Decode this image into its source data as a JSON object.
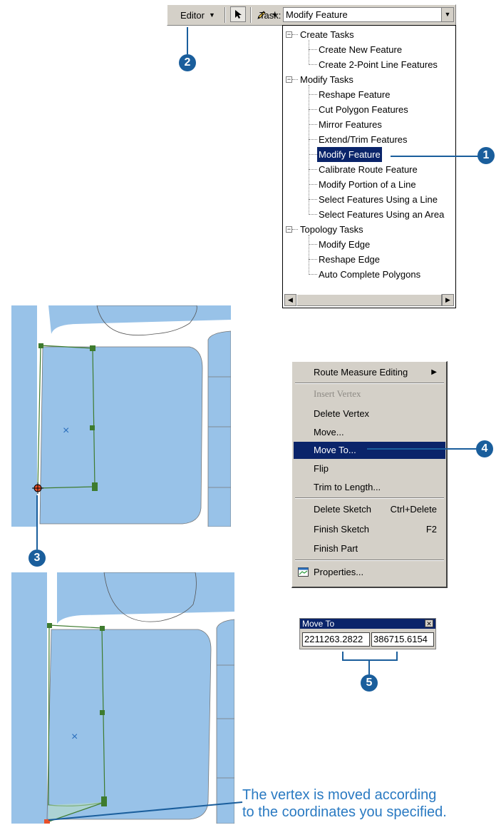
{
  "toolbar": {
    "editor_label": "Editor",
    "task_label": "Task:",
    "task_value": "Modify Feature"
  },
  "tree": {
    "groups": [
      {
        "label": "Create Tasks",
        "items": [
          "Create New Feature",
          "Create 2-Point Line Features"
        ]
      },
      {
        "label": "Modify Tasks",
        "items": [
          "Reshape Feature",
          "Cut Polygon Features",
          "Mirror Features",
          "Extend/Trim Features",
          "Modify Feature",
          "Calibrate Route Feature",
          "Modify Portion of a Line",
          "Select Features Using a Line",
          "Select Features Using an Area"
        ]
      },
      {
        "label": "Topology Tasks",
        "items": [
          "Modify Edge",
          "Reshape Edge",
          "Auto Complete Polygons"
        ]
      }
    ],
    "selected": "Modify Feature"
  },
  "menu": {
    "route_measure_editing": "Route Measure Editing",
    "insert_vertex": "Insert Vertex",
    "delete_vertex": "Delete Vertex",
    "move": "Move...",
    "move_to": "Move To...",
    "flip": "Flip",
    "trim_to_length": "Trim to Length...",
    "delete_sketch": "Delete Sketch",
    "delete_sketch_shortcut": "Ctrl+Delete",
    "finish_sketch": "Finish Sketch",
    "finish_sketch_shortcut": "F2",
    "finish_part": "Finish Part",
    "properties": "Properties..."
  },
  "move_to_dialog": {
    "title": "Move To",
    "x": "2211263.2822",
    "y": "386715.6154"
  },
  "callouts": {
    "c1": "1",
    "c2": "2",
    "c3": "3",
    "c4": "4",
    "c5": "5"
  },
  "caption": {
    "line1": "The vertex is moved according",
    "line2": "to the coordinates you specified."
  },
  "colors": {
    "callout": "#1a5e9c",
    "caption": "#2a7ac2",
    "parcel": "#98c2e8",
    "sketch": "#3e7b2e",
    "highlight": "#0a246a"
  }
}
